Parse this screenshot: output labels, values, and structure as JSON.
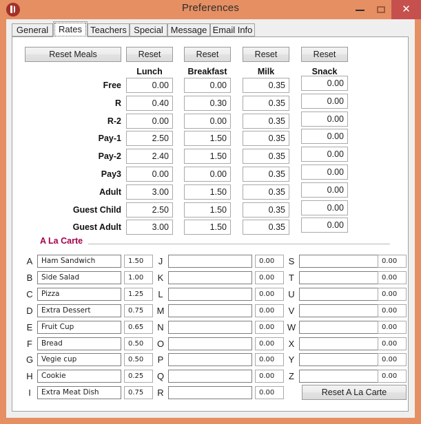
{
  "window": {
    "title": "Preferences",
    "icon": "app-icon",
    "controls": {
      "minimize": "–",
      "maximize": "□",
      "close": "✕"
    },
    "colors": {
      "frame": "#e58f63",
      "close": "#c6504e",
      "accent": "#a3004c",
      "client": "#efefef"
    }
  },
  "tabs": [
    {
      "label": "General",
      "active": false
    },
    {
      "label": "Rates",
      "active": true
    },
    {
      "label": "Teachers",
      "active": false
    },
    {
      "label": "Special",
      "active": false
    },
    {
      "label": "Message",
      "active": false
    },
    {
      "label": "Email Info",
      "active": false
    }
  ],
  "rates": {
    "reset_meals_label": "Reset Meals",
    "reset_label": "Reset",
    "columns": [
      "Lunch",
      "Breakfast",
      "Milk",
      "Snack"
    ],
    "rows": [
      {
        "label": "Free",
        "values": [
          "0.00",
          "0.00",
          "0.35",
          "0.00"
        ]
      },
      {
        "label": "R",
        "values": [
          "0.40",
          "0.30",
          "0.35",
          "0.00"
        ]
      },
      {
        "label": "R-2",
        "values": [
          "0.00",
          "0.00",
          "0.35",
          "0.00"
        ]
      },
      {
        "label": "Pay-1",
        "values": [
          "2.50",
          "1.50",
          "0.35",
          "0.00"
        ]
      },
      {
        "label": "Pay-2",
        "values": [
          "2.40",
          "1.50",
          "0.35",
          "0.00"
        ]
      },
      {
        "label": "Pay3",
        "values": [
          "0.00",
          "0.00",
          "0.35",
          "0.00"
        ]
      },
      {
        "label": "Adult",
        "values": [
          "3.00",
          "1.50",
          "0.35",
          "0.00"
        ]
      },
      {
        "label": "Guest Child",
        "values": [
          "2.50",
          "1.50",
          "0.35",
          "0.00"
        ]
      },
      {
        "label": "Guest Adult",
        "values": [
          "3.00",
          "1.50",
          "0.35",
          "0.00"
        ]
      }
    ]
  },
  "a_la_carte": {
    "title": "A La Carte",
    "reset_label": "Reset A La Carte",
    "column1": [
      {
        "letter": "A",
        "name": "Ham Sandwich",
        "price": "1.50"
      },
      {
        "letter": "B",
        "name": "Side Salad",
        "price": "1.00"
      },
      {
        "letter": "C",
        "name": "Pizza",
        "price": "1.25"
      },
      {
        "letter": "D",
        "name": "Extra Dessert",
        "price": "0.75"
      },
      {
        "letter": "E",
        "name": "Fruit Cup",
        "price": "0.65"
      },
      {
        "letter": "F",
        "name": "Bread",
        "price": "0.50"
      },
      {
        "letter": "G",
        "name": "Vegie cup",
        "price": "0.50"
      },
      {
        "letter": "H",
        "name": "Cookie",
        "price": "0.25"
      },
      {
        "letter": "I",
        "name": "Extra Meat Dish",
        "price": "0.75"
      }
    ],
    "column2": [
      {
        "letter": "J",
        "name": "",
        "price": "0.00"
      },
      {
        "letter": "K",
        "name": "",
        "price": "0.00"
      },
      {
        "letter": "L",
        "name": "",
        "price": "0.00"
      },
      {
        "letter": "M",
        "name": "",
        "price": "0.00"
      },
      {
        "letter": "N",
        "name": "",
        "price": "0.00"
      },
      {
        "letter": "O",
        "name": "",
        "price": "0.00"
      },
      {
        "letter": "P",
        "name": "",
        "price": "0.00"
      },
      {
        "letter": "Q",
        "name": "",
        "price": "0.00"
      },
      {
        "letter": "R",
        "name": "",
        "price": "0.00"
      }
    ],
    "column3": [
      {
        "letter": "S",
        "name": "",
        "price": "0.00"
      },
      {
        "letter": "T",
        "name": "",
        "price": "0.00"
      },
      {
        "letter": "U",
        "name": "",
        "price": "0.00"
      },
      {
        "letter": "V",
        "name": "",
        "price": "0.00"
      },
      {
        "letter": "W",
        "name": "",
        "price": "0.00"
      },
      {
        "letter": "X",
        "name": "",
        "price": "0.00"
      },
      {
        "letter": "Y",
        "name": "",
        "price": "0.00"
      },
      {
        "letter": "Z",
        "name": "",
        "price": "0.00"
      }
    ]
  }
}
